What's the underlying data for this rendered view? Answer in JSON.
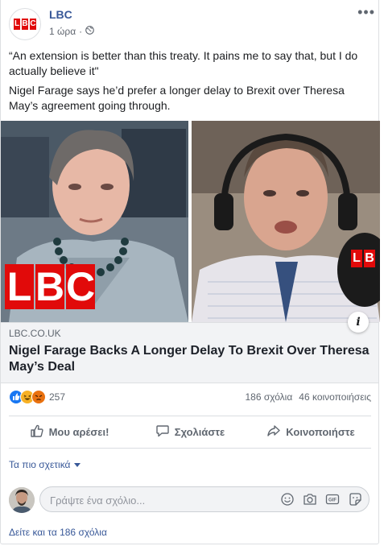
{
  "post": {
    "page_name": "LBC",
    "time": "1 ώρα",
    "text_lines": [
      "“An extension is better than this treaty. It pains me to say that, but I do actually believe it\"",
      "Nigel Farage says he’d prefer a longer delay to Brexit over Theresa May’s agreement going through."
    ]
  },
  "link": {
    "domain": "LBC.CO.UK",
    "title": "Nigel Farage Backs A Longer Delay To Brexit Over Theresa May’s Deal"
  },
  "stats": {
    "reaction_count": "257",
    "comments": "186 σχόλια",
    "shares": "46 κοινοποιήσεις"
  },
  "actions": {
    "like": "Μου αρέσει!",
    "comment": "Σχολιάστε",
    "share": "Κοινοποιήστε"
  },
  "sort_label": "Τα πιο σχετικά",
  "comment_box": {
    "placeholder": "Γράψτε ένα σχόλιο..."
  },
  "view_comments": "Δείτε και τα 186 σχόλια",
  "logo": {
    "letters": [
      "L",
      "B",
      "C"
    ],
    "mic_letters": [
      "L",
      "B"
    ]
  },
  "colors": {
    "link_blue": "#385898",
    "like_blue": "#1877f2",
    "haha_yellow": "#f7b125",
    "angry_red": "#e9710f",
    "lbc_red": "#e10a0a"
  }
}
